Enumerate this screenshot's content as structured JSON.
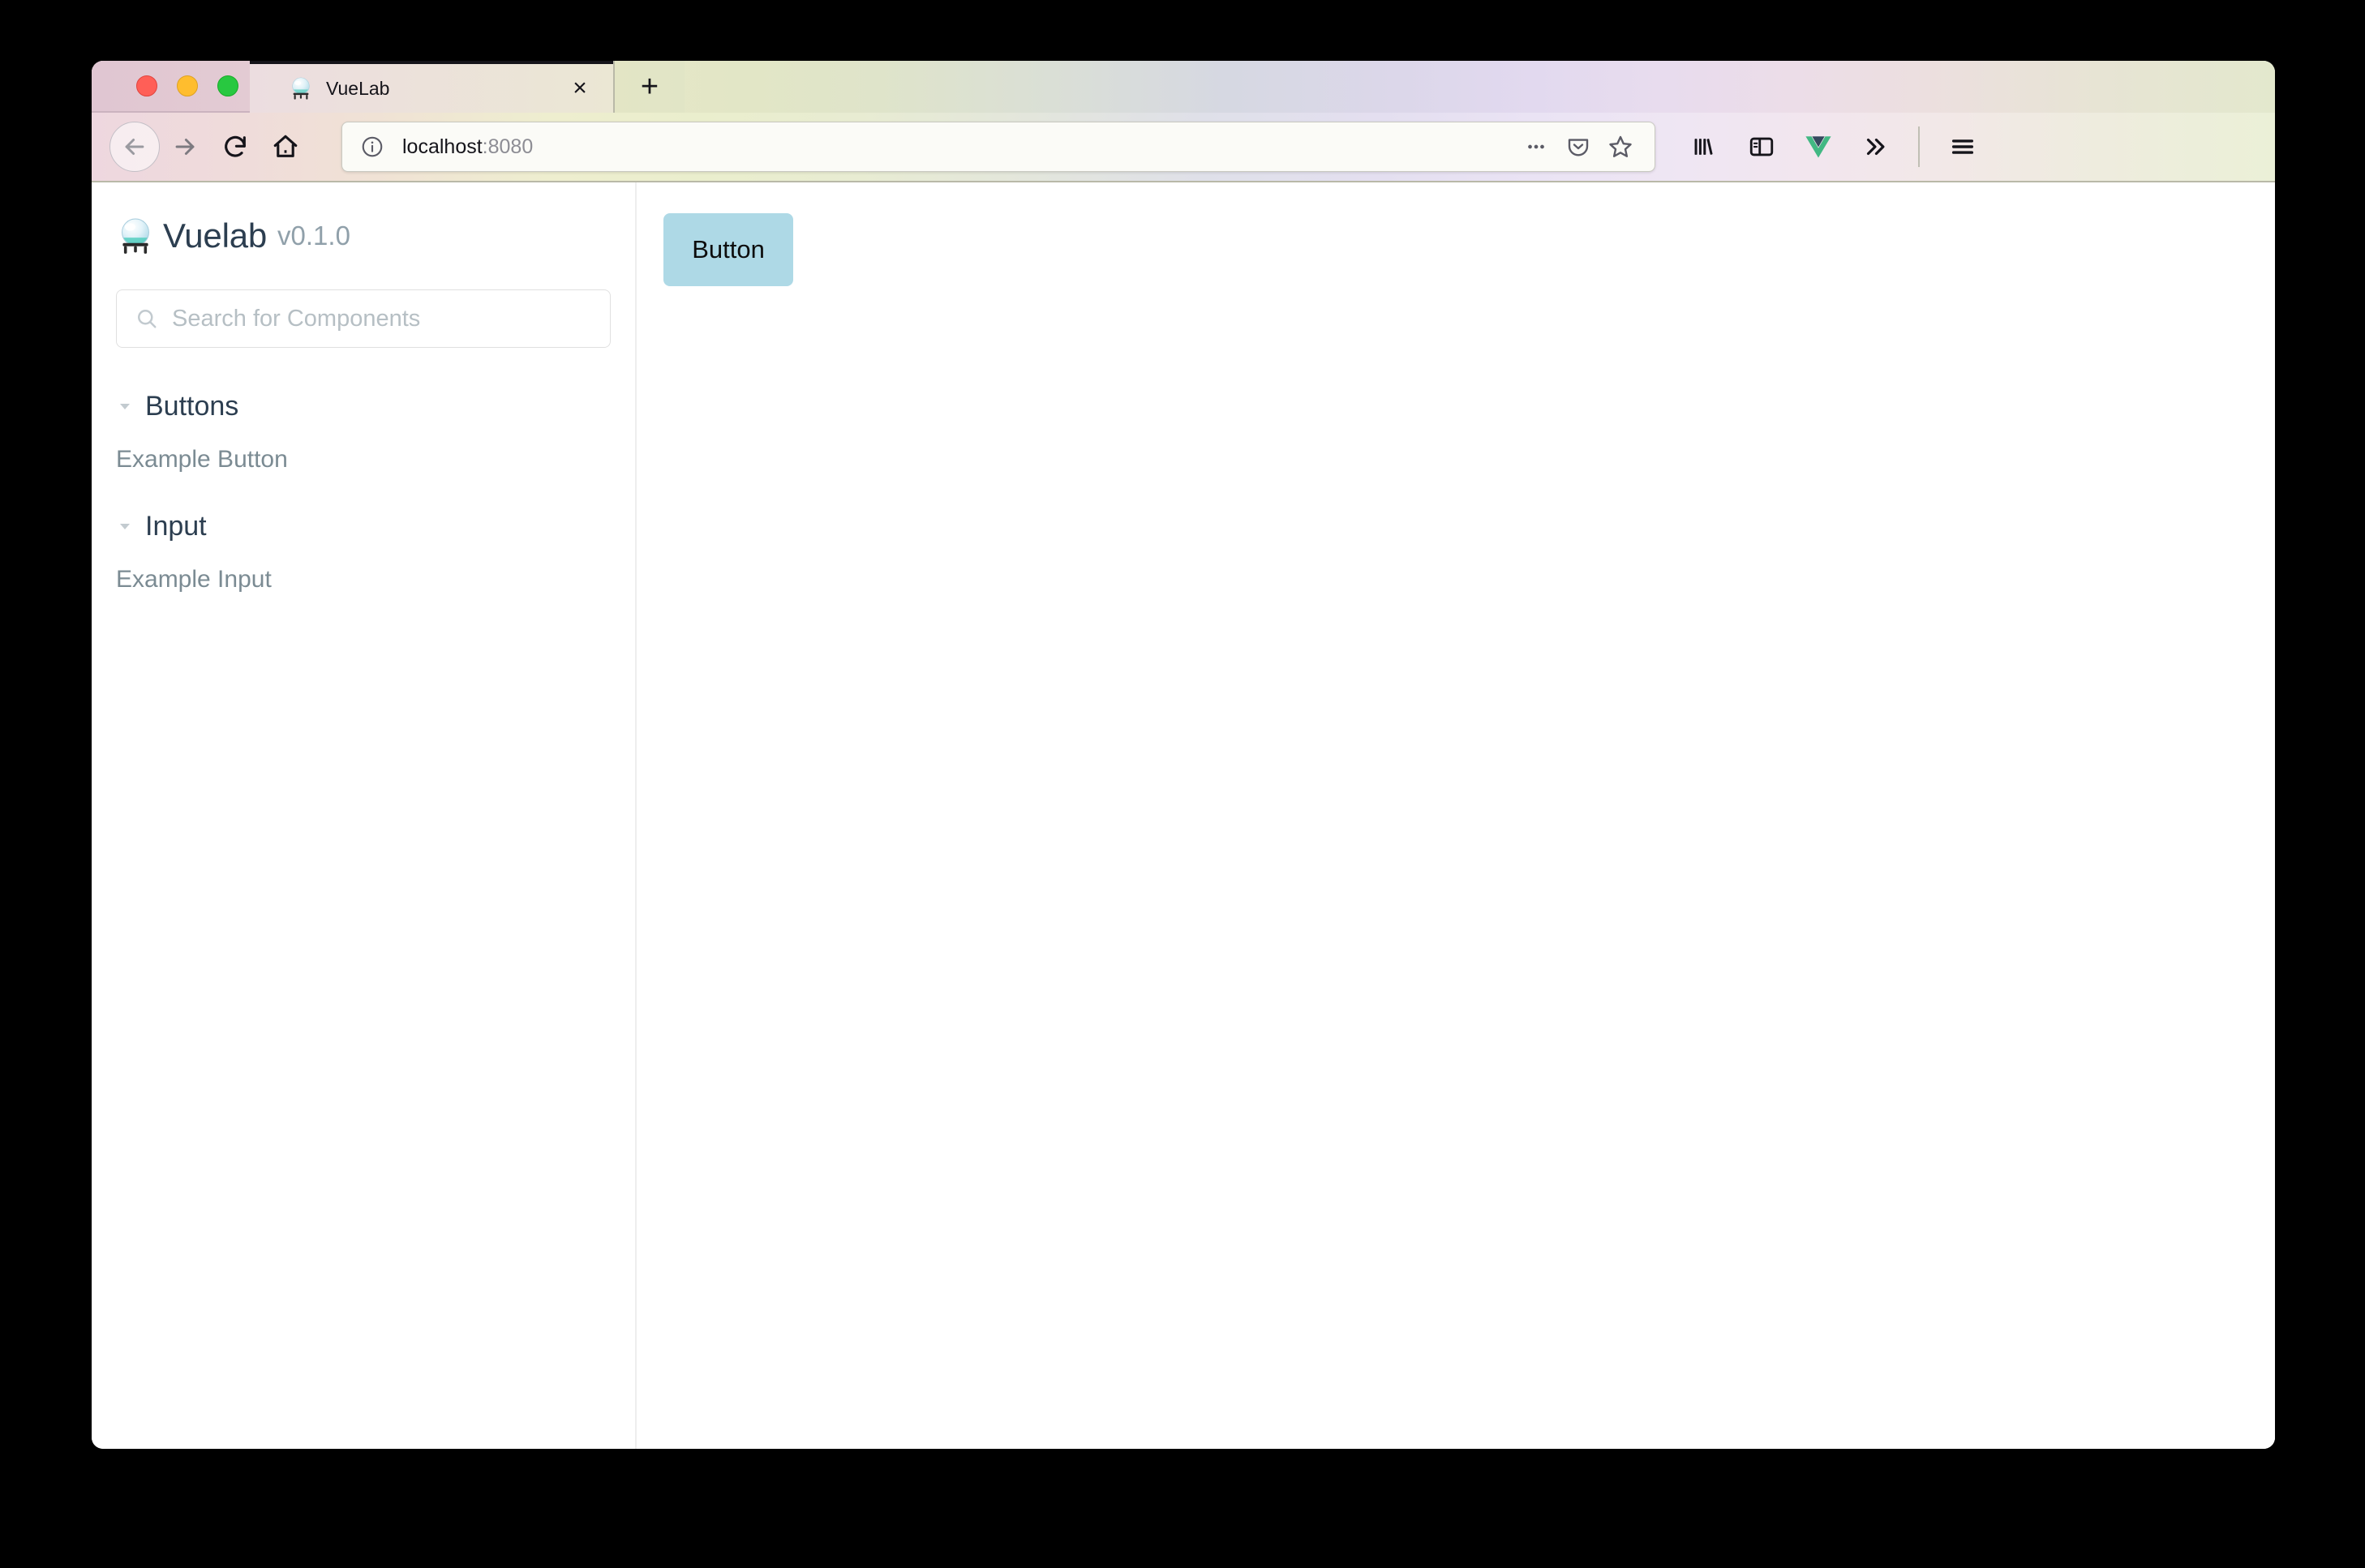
{
  "window": {
    "traffic_lights": [
      "close",
      "minimize",
      "maximize"
    ]
  },
  "tabs": {
    "active": {
      "title": "VueLab",
      "favicon": "crystal-ball-icon",
      "close_label": "×"
    },
    "new_tab_label": "+"
  },
  "toolbar": {
    "back": "back-arrow-icon",
    "forward": "forward-arrow-icon",
    "reload": "reload-icon",
    "home": "home-icon",
    "identity": "info-circle-icon",
    "url_host": "localhost",
    "url_port": ":8080",
    "url_full": "localhost:8080",
    "page_actions_label": "•••",
    "pocket": "pocket-icon",
    "bookmark": "star-icon",
    "library": "library-icon",
    "sidebar_toggle": "sidebar-icon",
    "vue_devtools": "vue-logo-icon",
    "overflow": "chevron-double-right-icon",
    "app_menu": "hamburger-menu-icon"
  },
  "sidebar": {
    "brand_name": "Vuelab",
    "brand_version": "v0.1.0",
    "brand_logo": "crystal-ball-icon",
    "search": {
      "placeholder": "Search for Components",
      "value": "",
      "icon": "search-icon"
    },
    "groups": [
      {
        "label": "Buttons",
        "expanded": true,
        "items": [
          {
            "label": "Example Button"
          }
        ]
      },
      {
        "label": "Input",
        "expanded": true,
        "items": [
          {
            "label": "Example Input"
          }
        ]
      }
    ]
  },
  "preview": {
    "demo_button_label": "Button"
  },
  "colors": {
    "brand_dark": "#2c3e50",
    "muted_text": "#7b8b93",
    "demo_button_bg": "#aed9e6",
    "vue_green": "#42b883",
    "vue_dark": "#35495e"
  }
}
